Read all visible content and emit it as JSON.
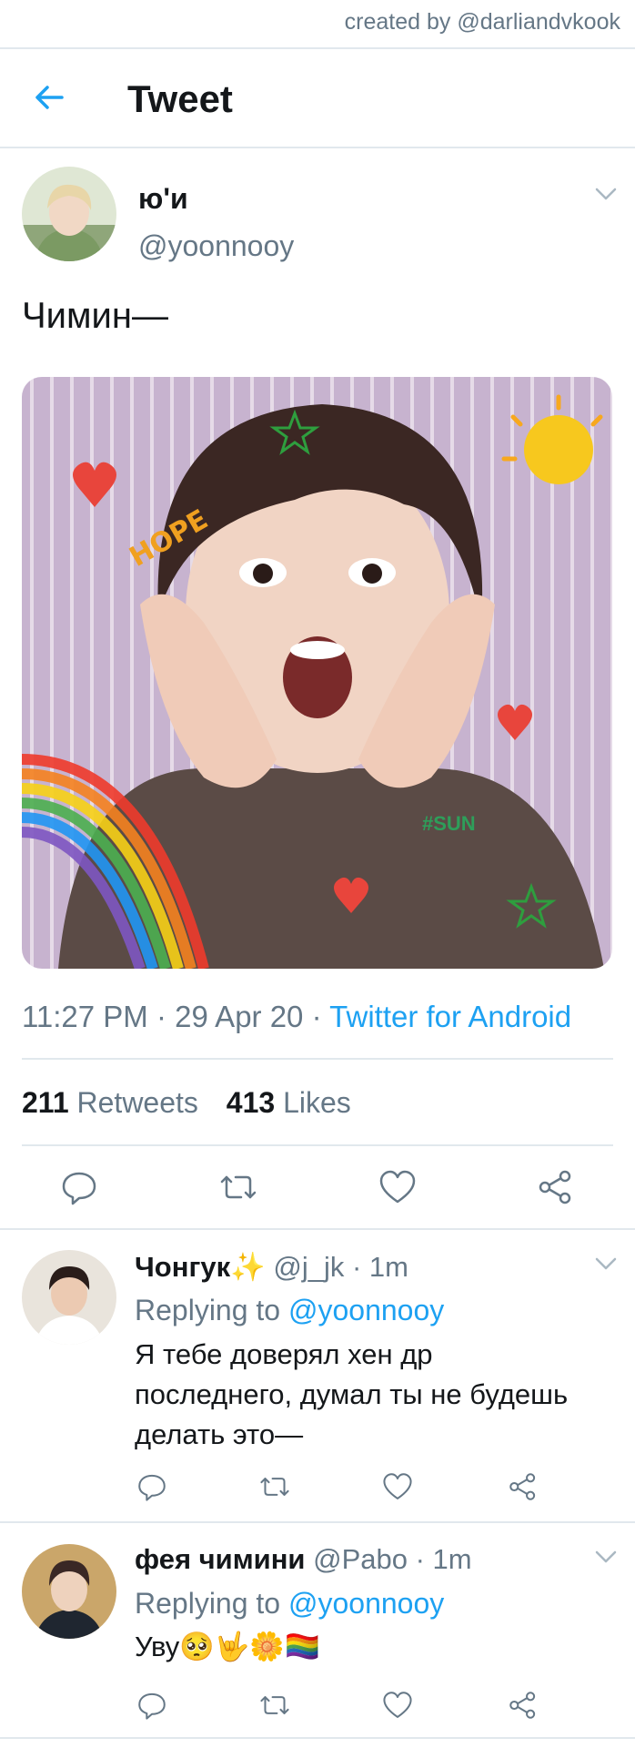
{
  "watermark": "created by @darliandvkook",
  "header": {
    "title": "Tweet"
  },
  "tweet": {
    "author": {
      "name": "ю'и",
      "handle": "@yoonnooy"
    },
    "text": "Чимин—",
    "time": "11:27 PM · 29 Apr 20 ·",
    "source": "Twitter for Android",
    "retweets": {
      "count": "211",
      "label": "Retweets"
    },
    "likes": {
      "count": "413",
      "label": "Likes"
    },
    "media_doodles": [
      "HOPE",
      "#SUN"
    ]
  },
  "replies": [
    {
      "name": "Чонгук✨",
      "handle": "@j_jk",
      "time": "· 1m",
      "replying_label": "Replying to",
      "replying_to": "@yoonnooy",
      "lines": [
        "Я тебе доверял хен др",
        "последнего, думал ты не будешь",
        "делать это—"
      ]
    },
    {
      "name": "фея чимини",
      "handle": "@Pabo",
      "time": "· 1m",
      "replying_label": "Replying to",
      "replying_to": "@yoonnooy",
      "lines": [
        "Уву🥺🤟🌼🏳️‍🌈"
      ]
    }
  ],
  "colors": {
    "accent": "#1da1f2",
    "secondary_text": "#657786",
    "divider": "#e1e8ed"
  }
}
